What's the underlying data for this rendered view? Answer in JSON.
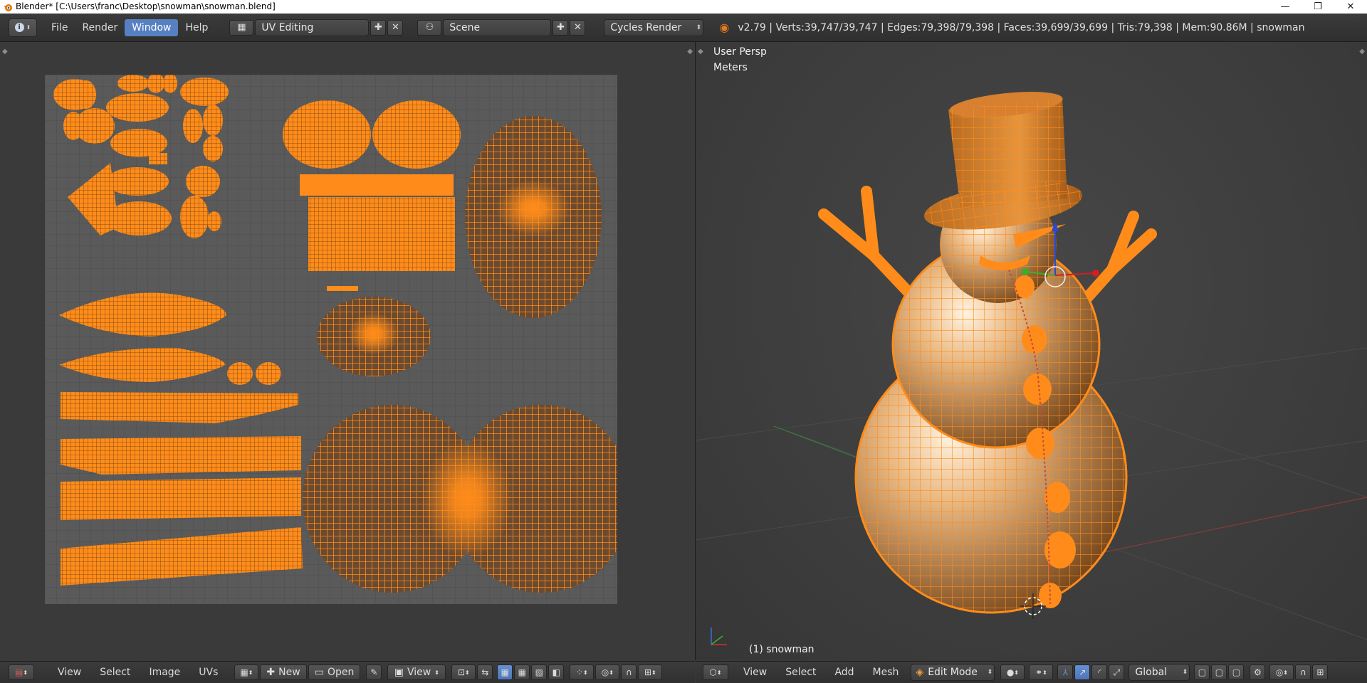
{
  "window": {
    "title": "Blender* [C:\\Users\\franc\\Desktop\\snowman\\snowman.blend]",
    "controls": [
      "—",
      "❐",
      "✕"
    ]
  },
  "info_header": {
    "menus": [
      "File",
      "Render",
      "Window",
      "Help"
    ],
    "active_menu": "Window",
    "screen_layout": "UV Editing",
    "scene": "Scene",
    "render_engine": "Cycles Render",
    "stats": "v2.79 | Verts:39,747/39,747 | Edges:79,398/79,398 | Faces:39,699/39,699 | Tris:79,398 | Mem:90.86M | snowman"
  },
  "viewport": {
    "view_name": "User Persp",
    "units": "Meters",
    "object_label": "(1) snowman",
    "accent_color": "#ff8c1a"
  },
  "uv_header": {
    "menus": [
      "View",
      "Select",
      "Image",
      "UVs"
    ],
    "new_label": "New",
    "open_label": "Open",
    "view_dropdown": "View"
  },
  "view3d_header": {
    "menus": [
      "View",
      "Select",
      "Add",
      "Mesh"
    ],
    "mode": "Edit Mode",
    "orientation": "Global"
  }
}
